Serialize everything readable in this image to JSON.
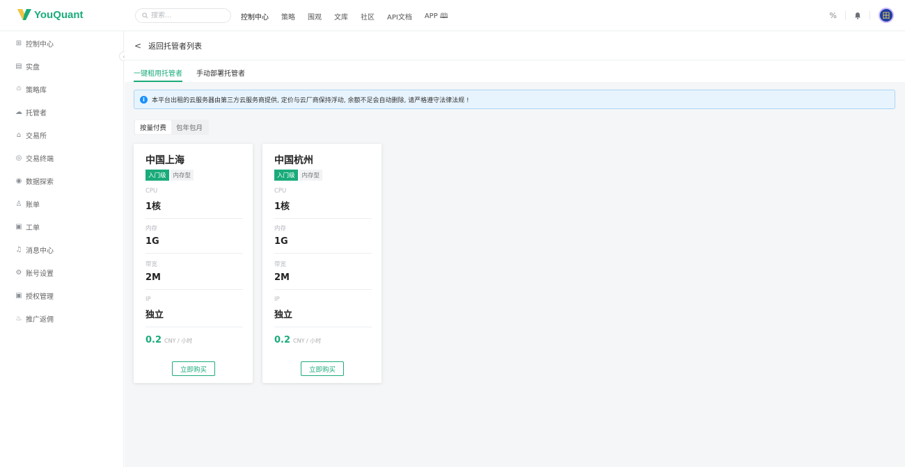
{
  "brand": {
    "name": "YouQuant",
    "color": "#1aab7a"
  },
  "search": {
    "placeholder": "搜索..."
  },
  "nav": [
    "控制中心",
    "策略",
    "围观",
    "文库",
    "社区",
    "API文档",
    "APP 🕮"
  ],
  "top_right": {
    "percent_icon": "percent-icon",
    "bell_icon": "bell-icon",
    "avatar_text": "田"
  },
  "sidebar": {
    "items": [
      {
        "label": "控制中心",
        "icon": "dashboard-icon",
        "glyph": "⊞"
      },
      {
        "label": "实盘",
        "icon": "list-icon",
        "glyph": "▤"
      },
      {
        "label": "策略库",
        "icon": "strategy-icon",
        "glyph": "♲"
      },
      {
        "label": "托管者",
        "icon": "cloud-icon",
        "glyph": "☁"
      },
      {
        "label": "交易所",
        "icon": "bank-icon",
        "glyph": "⌂"
      },
      {
        "label": "交易终端",
        "icon": "terminal-icon",
        "glyph": "◎"
      },
      {
        "label": "数据探索",
        "icon": "explore-icon",
        "glyph": "◉"
      },
      {
        "label": "账单",
        "icon": "user-bill-icon",
        "glyph": "♙"
      },
      {
        "label": "工单",
        "icon": "ticket-icon",
        "glyph": "▣"
      },
      {
        "label": "消息中心",
        "icon": "bell-icon",
        "glyph": "♫"
      },
      {
        "label": "账号设置",
        "icon": "gear-icon",
        "glyph": "⚙"
      },
      {
        "label": "授权管理",
        "icon": "auth-icon",
        "glyph": "▣"
      },
      {
        "label": "推广返佣",
        "icon": "gift-icon",
        "glyph": "♨"
      }
    ]
  },
  "back": {
    "label": "返回托管者列表"
  },
  "tabs": [
    {
      "label": "一键租用托管者",
      "active": true
    },
    {
      "label": "手动部署托管者",
      "active": false
    }
  ],
  "notice": {
    "text": "本平台出租的云服务器由第三方云服务商提供, 定价与云厂商保持浮动, 余额不足会自动删除, 请严格遵守法律法规 !"
  },
  "billing": {
    "options": [
      "按量付费",
      "包年包月"
    ],
    "selected": "按量付费"
  },
  "cards": [
    {
      "city": "中国上海",
      "level_tag": "入门级",
      "type_tag": "内存型",
      "cpu_label": "CPU",
      "cpu": "1核",
      "mem_label": "内存",
      "mem": "1G",
      "bw_label": "带宽",
      "bw": "2M",
      "ip_label": "IP",
      "ip": "独立",
      "price": "0.2",
      "unit": "CNY / 小时",
      "buy_label": "立即购买"
    },
    {
      "city": "中国杭州",
      "level_tag": "入门级",
      "type_tag": "内存型",
      "cpu_label": "CPU",
      "cpu": "1核",
      "mem_label": "内存",
      "mem": "1G",
      "bw_label": "带宽",
      "bw": "2M",
      "ip_label": "IP",
      "ip": "独立",
      "price": "0.2",
      "unit": "CNY / 小时",
      "buy_label": "立即购买"
    }
  ]
}
